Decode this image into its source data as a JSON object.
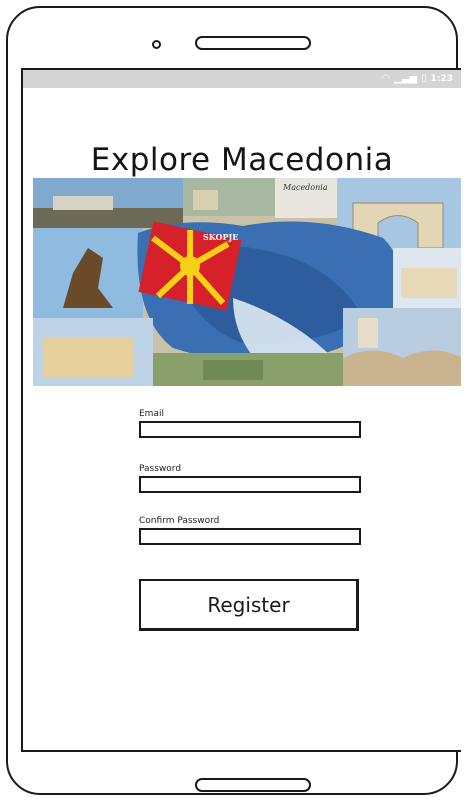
{
  "status_bar": {
    "wifi_icon": "wifi-icon",
    "signal_icon": "signal-icon",
    "battery_icon": "battery-icon",
    "time": "1:23"
  },
  "page_title": "Explore Macedonia",
  "banner_labels": {
    "macedonia": "Macedonia",
    "skopje": "SKOPJE"
  },
  "form": {
    "email_label": "Email",
    "email_value": "",
    "password_label": "Password",
    "password_value": "",
    "confirm_label": "Confirm Password",
    "confirm_value": "",
    "register_label": "Register"
  },
  "colors": {
    "flag_red": "#d6202a",
    "flag_yellow": "#f7d116",
    "sky": "#9ec6e6",
    "water": "#3a6fb3"
  }
}
